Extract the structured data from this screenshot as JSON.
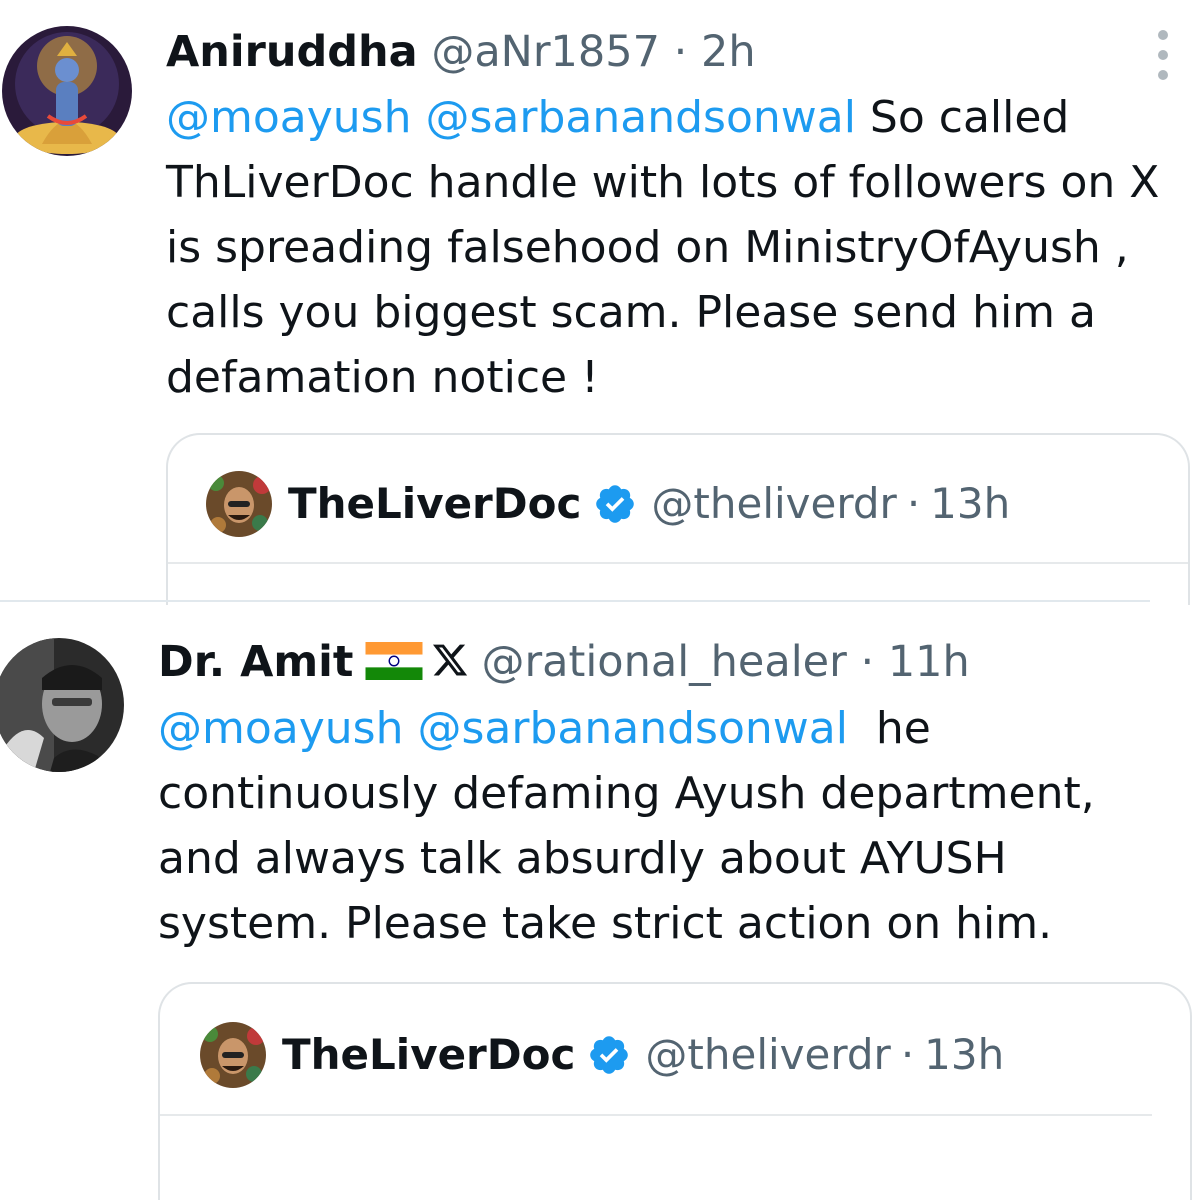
{
  "tweets": [
    {
      "author_name": "Aniruddha",
      "handle": "@aNr1857",
      "separator": "·",
      "time": "2h",
      "body": {
        "mention_1": "@moayush",
        "mention_2": "@sarbanandsonwal",
        "line_1_rest": " So called",
        "line_2": "ThLiverDoc handle with lots of followers on X",
        "line_3": "is spreading falsehood on MinistryOfAyush ,",
        "line_4": "calls you biggest scam. Please send him a",
        "line_5": "defamation notice !"
      },
      "avatar_icon": "deity-avatar",
      "menu_icon": "more-options-icon",
      "quote": {
        "author_name": "TheLiverDoc",
        "verified_icon": "verified-badge-icon",
        "handle": "@theliverdr",
        "separator": "·",
        "time": "13h"
      }
    },
    {
      "author_name": "Dr. Amit",
      "flag_icon": "india-flag-icon",
      "x_icon": "x-logo-icon",
      "handle": "@rational_healer",
      "separator": "·",
      "time": "11h",
      "body": {
        "mention_1": "@moayush",
        "mention_2": "@sarbanandsonwal",
        "line_1_rest": "  he",
        "line_2": "continuously defaming Ayush department,",
        "line_3": "and always talk absurdly about AYUSH",
        "line_4": "system. Please take strict action on him."
      },
      "avatar_icon": "person-avatar",
      "quote": {
        "author_name": "TheLiverDoc",
        "verified_icon": "verified-badge-icon",
        "handle": "@theliverdr",
        "separator": "·",
        "time": "13h"
      }
    }
  ],
  "colors": {
    "mention": "#1d9bf0",
    "secondary_text": "#536471",
    "primary_text": "#0f1419",
    "verified": "#1d9bf0"
  }
}
